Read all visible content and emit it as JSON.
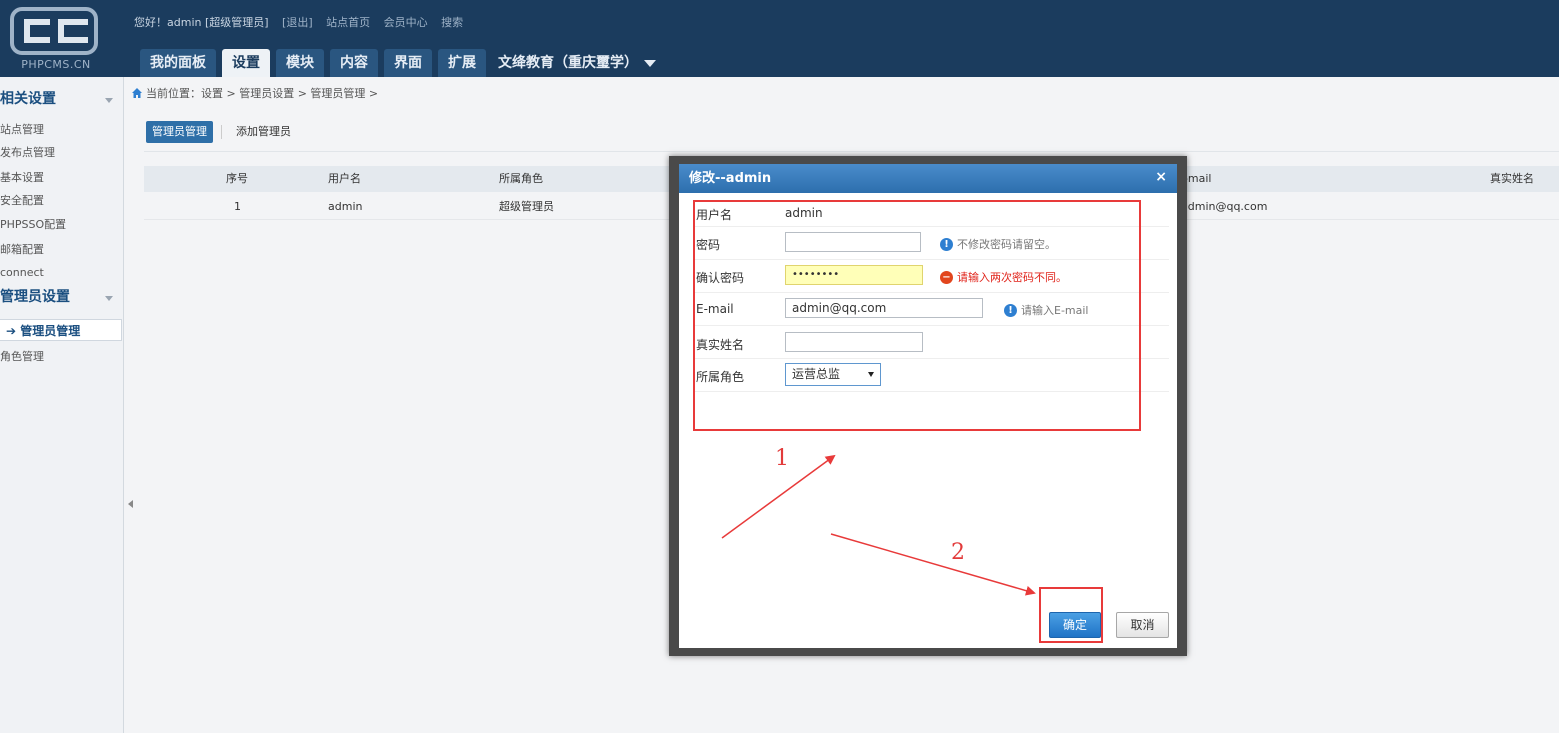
{
  "header": {
    "logo_text": "PHPCMS.CN",
    "greeting": "您好！admin [超级管理员]",
    "logout": "[退出]",
    "site_home": "站点首页",
    "member_center": "会员中心",
    "search": "搜索",
    "nav": [
      "我的面板",
      "设置",
      "模块",
      "内容",
      "界面",
      "扩展"
    ],
    "site_name": "文绛教育（重庆璽学）"
  },
  "sidebar": {
    "group1_title": "相关设置",
    "group1_items": [
      "站点管理",
      "发布点管理",
      "基本设置",
      "安全配置",
      "PHPSSO配置",
      "邮箱配置",
      "connect"
    ],
    "group2_title": "管理员设置",
    "group2_items": [
      "管理员管理",
      "角色管理"
    ]
  },
  "breadcrumb": "当前位置：设置 > 管理员设置 > 管理员管理 >",
  "subtabs": {
    "admin_manage": "管理员管理",
    "add_admin": "添加管理员"
  },
  "table": {
    "headers": [
      "序号",
      "用户名",
      "所属角色",
      "E-mail",
      "真实姓名"
    ],
    "row": {
      "index": "1",
      "username": "admin",
      "role": "超级管理员",
      "email": "admin@qq.com"
    }
  },
  "dialog": {
    "title": "修改--admin",
    "close": "×",
    "fields": {
      "username_label": "用户名",
      "username_value": "admin",
      "password_label": "密码",
      "password_hint": "不修改密码请留空。",
      "confirm_label": "确认密码",
      "confirm_value": "••••••••",
      "confirm_error": "请输入两次密码不同。",
      "email_label": "E-mail",
      "email_value": "admin@qq.com",
      "email_hint": "请输入E-mail",
      "realname_label": "真实姓名",
      "role_label": "所属角色",
      "role_value": "运营总监"
    },
    "ok": "确定",
    "cancel": "取消"
  },
  "annotations": {
    "label1": "1",
    "label2": "2",
    "color": "#e83a3a"
  }
}
